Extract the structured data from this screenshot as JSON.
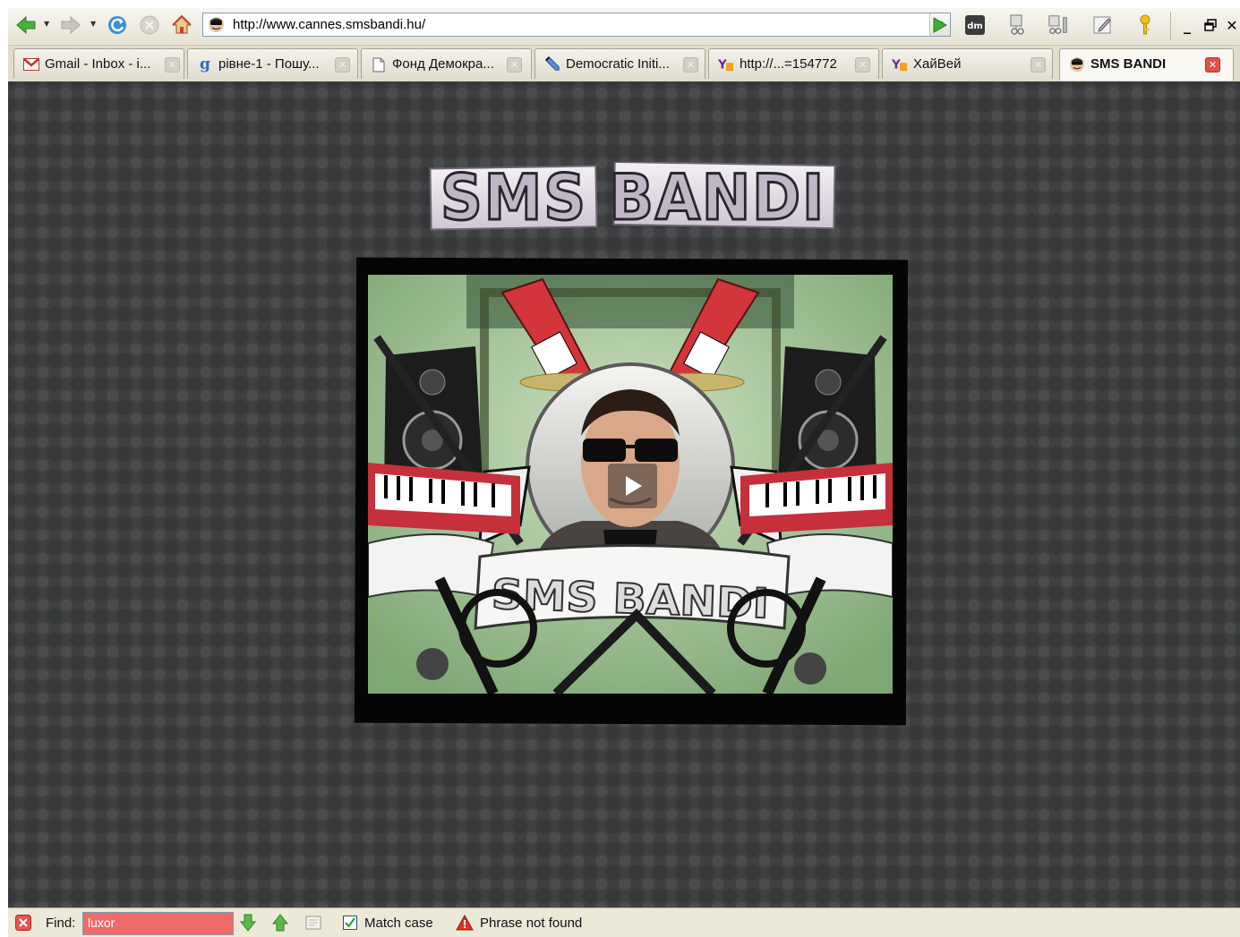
{
  "browser": {
    "url": "http://www.cannes.smsbandi.hu/",
    "tabs": [
      {
        "label": "Gmail - Inbox - i...",
        "icon": "gmail-icon",
        "active": false
      },
      {
        "label": "рівне-1 - Пошу...",
        "icon": "google-icon",
        "active": false
      },
      {
        "label": "Фонд Демокра...",
        "icon": "page-icon",
        "active": false
      },
      {
        "label": "Democratic Initi...",
        "icon": "pencil-icon",
        "active": false
      },
      {
        "label": "http://...=154772",
        "icon": "yahoo-icon",
        "active": false
      },
      {
        "label": "ХайВей",
        "icon": "yahoo-icon",
        "active": false
      },
      {
        "label": "SMS BANDI",
        "icon": "smsbandi-icon",
        "active": true
      }
    ]
  },
  "page": {
    "logo_text": "SMS BANDI",
    "video": {
      "banner_text": "SMS BANDI",
      "play_label": "play"
    }
  },
  "findbar": {
    "find_label": "Find:",
    "query": "luxor",
    "match_case_label": "Match case",
    "match_case_checked": true,
    "status_text": "Phrase not found"
  },
  "colors": {
    "page_background": "#3d3f40",
    "find_input_error": "#f06a6a",
    "active_tab_close": "#e55046"
  }
}
